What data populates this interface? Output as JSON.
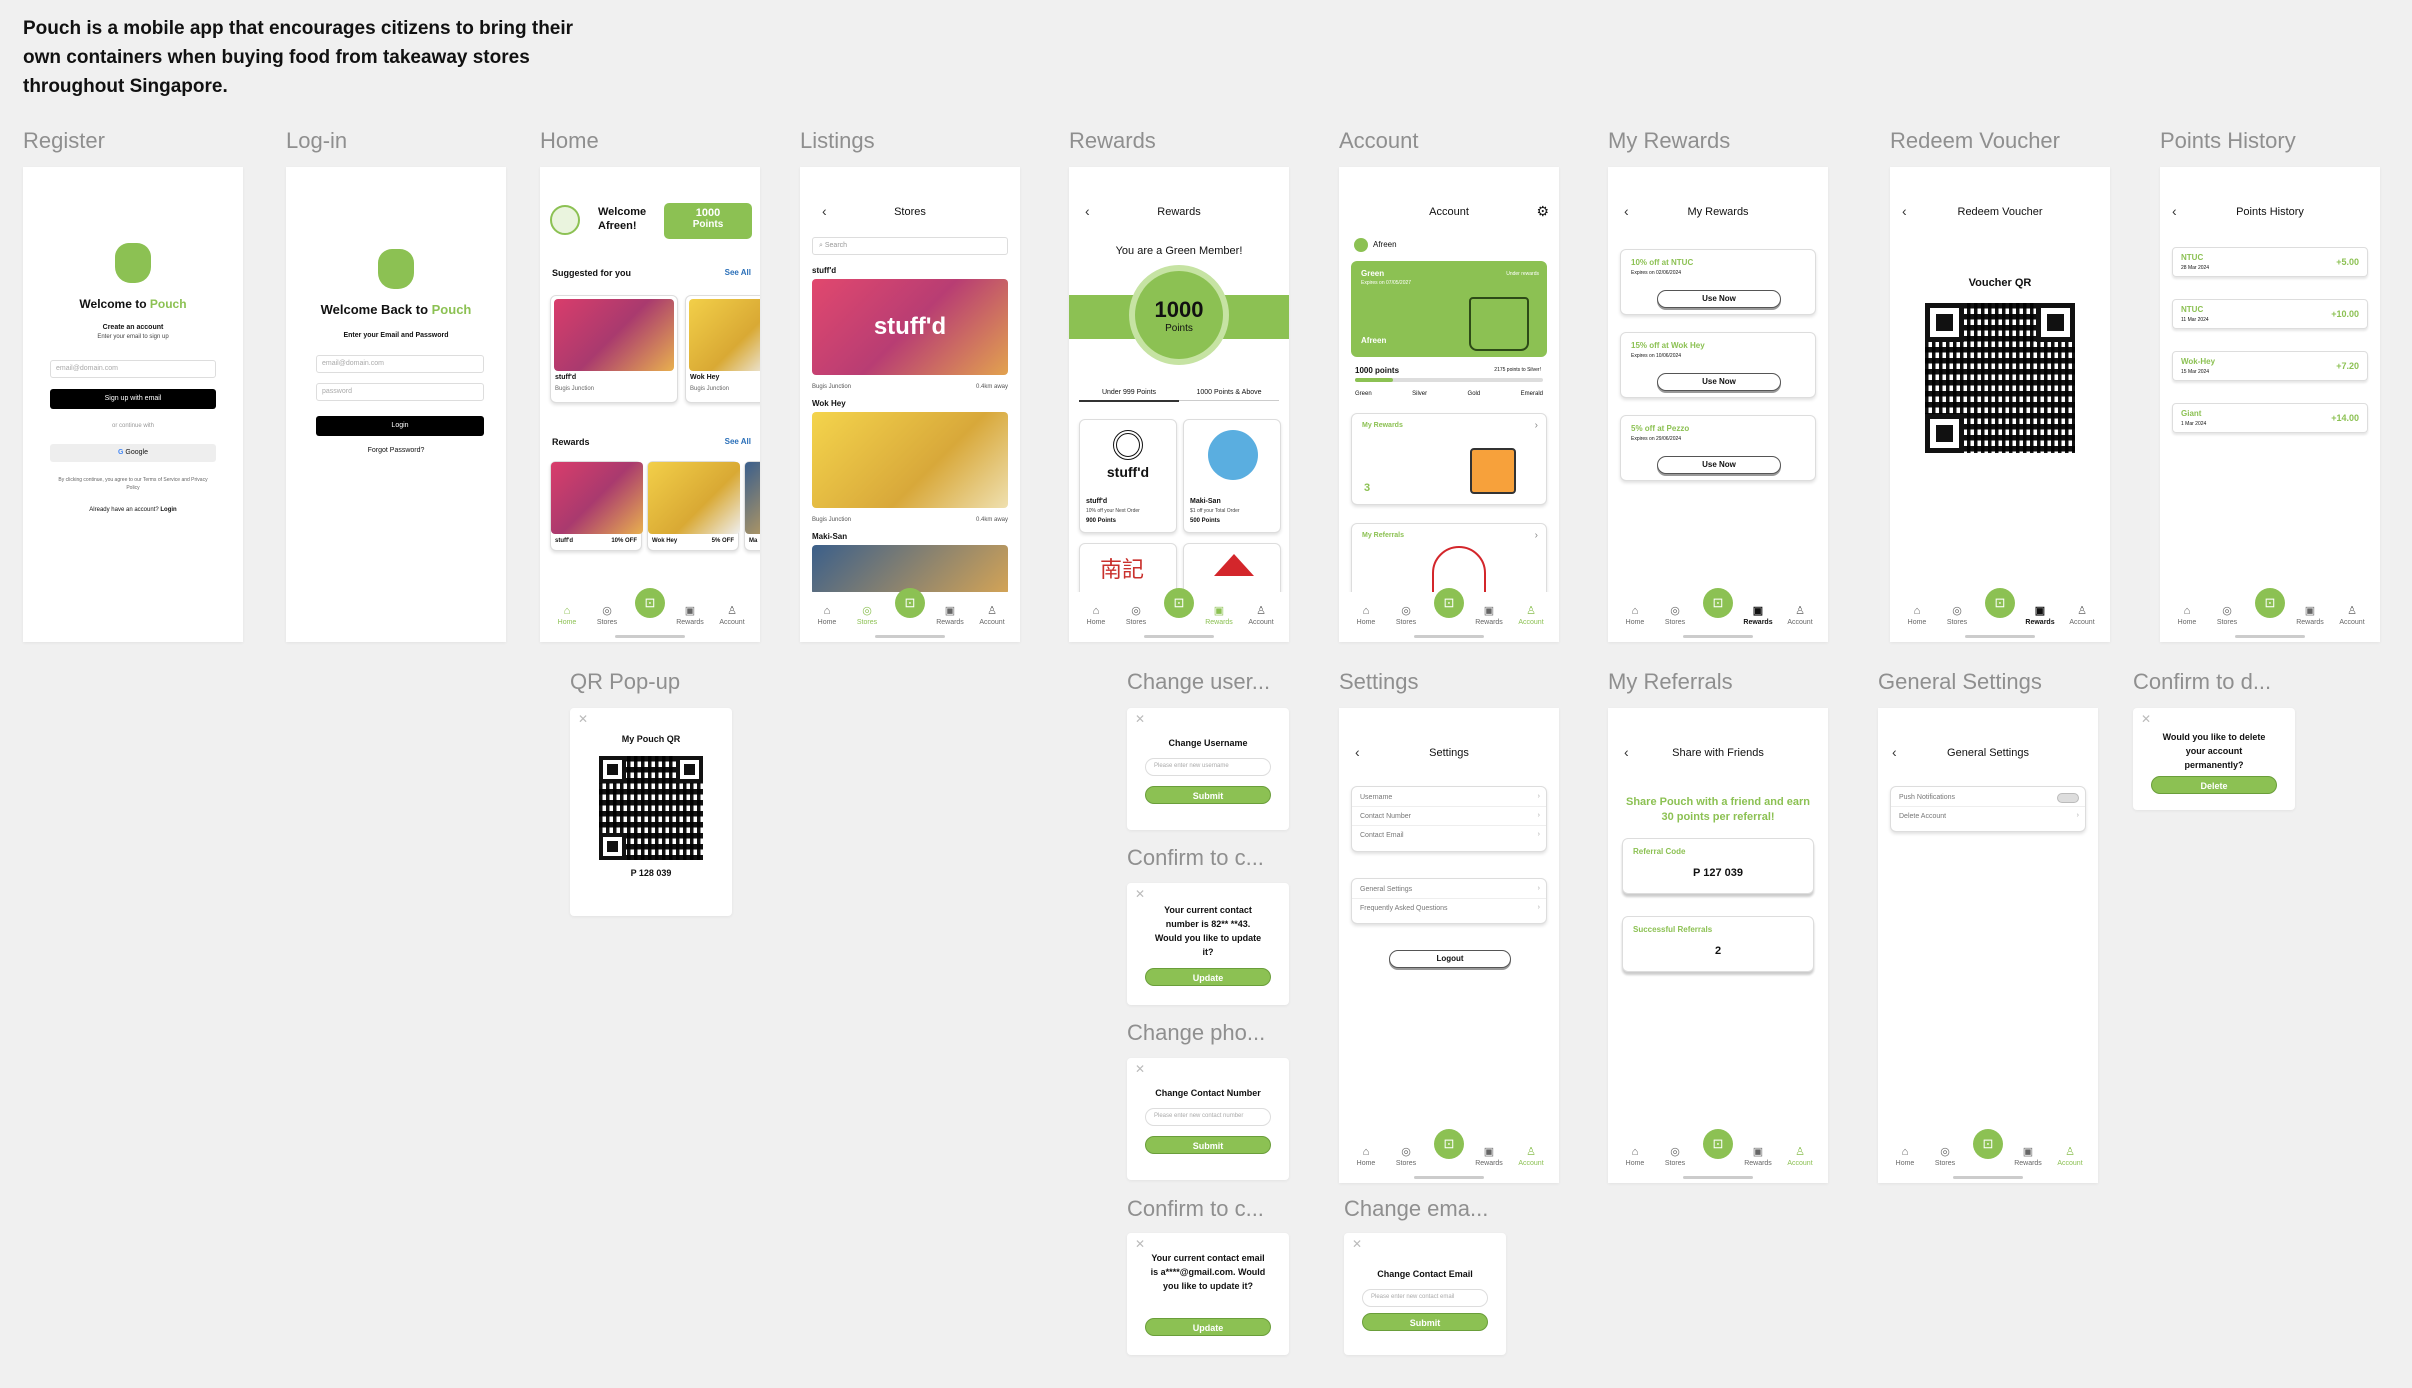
{
  "intro": "Pouch is a mobile app that encourages citizens to bring their own containers when buying food from takeaway stores throughout Singapore.",
  "labels": {
    "register": "Register",
    "login": "Log-in",
    "home": "Home",
    "listings": "Listings",
    "rewards": "Rewards",
    "account": "Account",
    "my_rewards": "My Rewards",
    "redeem_voucher": "Redeem Voucher",
    "points_history": "Points History",
    "qr_popup": "QR Pop-up",
    "change_user": "Change user...",
    "confirm_contact": "Confirm to c...",
    "change_phone": "Change pho...",
    "confirm_email": "Confirm to c...",
    "settings": "Settings",
    "change_email": "Change ema...",
    "my_referrals": "My Referrals",
    "general_settings": "General Settings",
    "confirm_delete": "Confirm to d..."
  },
  "tabs": {
    "home": "Home",
    "stores": "Stores",
    "rewards": "Rewards",
    "account": "Account"
  },
  "register": {
    "welcome_pre": "Welcome to ",
    "brand": "Pouch",
    "subtitle": "Create an account",
    "hint": "Enter your email to sign up",
    "email_placeholder": "email@domain.com",
    "signup": "Sign up with email",
    "or": "or continue with",
    "google": "Google",
    "terms": "By clicking continue, you agree to our Terms of Service and Privacy Policy",
    "already": "Already have an account? ",
    "login_link": "Login"
  },
  "login": {
    "welcome_pre": "Welcome Back to ",
    "brand": "Pouch",
    "subtitle": "Enter your Email and Password",
    "email_placeholder": "email@domain.com",
    "password_placeholder": "password",
    "login": "Login",
    "forgot": "Forgot Password?"
  },
  "home": {
    "welcome": "Welcome Afreen!",
    "points_value": "1000",
    "points_label": "Points",
    "suggested": "Suggested for you",
    "see_all": "See All",
    "stores": [
      {
        "name": "stuff'd",
        "loc": "Bugis Junction"
      },
      {
        "name": "Wok Hey",
        "loc": "Bugis Junction"
      }
    ],
    "rewards_title": "Rewards",
    "rewards": [
      {
        "name": "stuff'd",
        "off": "10% OFF"
      },
      {
        "name": "Wok Hey",
        "off": "5% OFF"
      },
      {
        "name": "Ma",
        "off": ""
      }
    ]
  },
  "listings": {
    "title": "Stores",
    "search": "Search",
    "items": [
      {
        "name": "stuff'd",
        "loc": "Bugis Junction",
        "dist": "0.4km away"
      },
      {
        "name": "Wok Hey",
        "loc": "Bugis Junction",
        "dist": "0.4km away"
      },
      {
        "name": "Maki-San",
        "loc": "",
        "dist": ""
      }
    ]
  },
  "rewards": {
    "title": "Rewards",
    "member": "You are a Green Member!",
    "points": "1000",
    "points_label": "Points",
    "tab1": "Under 999 Points",
    "tab2": "1000 Points & Above",
    "cards": [
      {
        "name": "stuff'd",
        "desc": "10% off your Next Order",
        "pts": "900 Points"
      },
      {
        "name": "Maki-San",
        "desc": "$1 off your Total Order",
        "pts": "500 Points"
      }
    ]
  },
  "account": {
    "title": "Account",
    "user": "Afreen",
    "tier": "Green",
    "expires": "Expires on 07/05/2027",
    "under": "Under rewards",
    "card_name": "Afreen",
    "points": "1000 points",
    "to_silver": "2175 points to Silver!",
    "tiers": [
      "Green",
      "Silver",
      "Gold",
      "Emerald"
    ],
    "my_rewards": "My Rewards",
    "rewards_count": "3",
    "my_referrals": "My Referrals"
  },
  "my_rewards": {
    "title": "My Rewards",
    "use_now": "Use Now",
    "items": [
      {
        "name": "10% off at NTUC",
        "exp": "Expires on 02/06/2024"
      },
      {
        "name": "15% off at Wok Hey",
        "exp": "Expires on 10/06/2024"
      },
      {
        "name": "5% off at Pezzo",
        "exp": "Expires on 29/06/2024"
      }
    ]
  },
  "redeem": {
    "title": "Redeem Voucher",
    "qr_label": "Voucher QR"
  },
  "history": {
    "title": "Points History",
    "items": [
      {
        "name": "NTUC",
        "date": "28 Mar 2024",
        "pts": "+5.00"
      },
      {
        "name": "NTUC",
        "date": "11 Mar 2024",
        "pts": "+10.00"
      },
      {
        "name": "Wok-Hey",
        "date": "15 Mar 2024",
        "pts": "+7.20"
      },
      {
        "name": "Giant",
        "date": "1 Mar 2024",
        "pts": "+14.00"
      }
    ]
  },
  "qr_popup": {
    "title": "My Pouch QR",
    "code": "P 128 039"
  },
  "change_user": {
    "title": "Change Username",
    "placeholder": "Please enter new username",
    "submit": "Submit"
  },
  "confirm_contact": {
    "text": "Your current contact number is 82** **43. Would you like to update it?",
    "update": "Update"
  },
  "change_phone": {
    "title": "Change Contact Number",
    "placeholder": "Please enter new contact number",
    "submit": "Submit"
  },
  "confirm_email": {
    "text": "Your current contact email is a****@gmail.com. Would you like to update it?",
    "update": "Update"
  },
  "settings": {
    "title": "Settings",
    "rows1": [
      "Username",
      "Contact Number",
      "Contact Email"
    ],
    "rows2": [
      "General Settings",
      "Frequently Asked Questions"
    ],
    "logout": "Logout"
  },
  "change_email": {
    "title": "Change Contact Email",
    "placeholder": "Please enter new contact email",
    "submit": "Submit"
  },
  "referrals": {
    "title": "Share with Friends",
    "headline": "Share Pouch with a friend and earn 30 points per referral!",
    "code_label": "Referral Code",
    "code": "P 127 039",
    "success_label": "Successful Referrals",
    "success": "2"
  },
  "general": {
    "title": "General Settings",
    "push": "Push Notifications",
    "delete": "Delete Account"
  },
  "delete_confirm": {
    "text": "Would you like to delete your account permanently?",
    "delete": "Delete"
  },
  "colors": {
    "accent": "#8cc153",
    "accent_dark": "#6a9e3a",
    "label": "#8f8f8f"
  },
  "icons": [
    "pouch-logo-icon",
    "home-icon",
    "stores-icon",
    "qr-icon",
    "rewards-icon",
    "account-icon",
    "back-icon",
    "gear-icon",
    "search-icon",
    "close-icon",
    "chevron-right-icon"
  ]
}
